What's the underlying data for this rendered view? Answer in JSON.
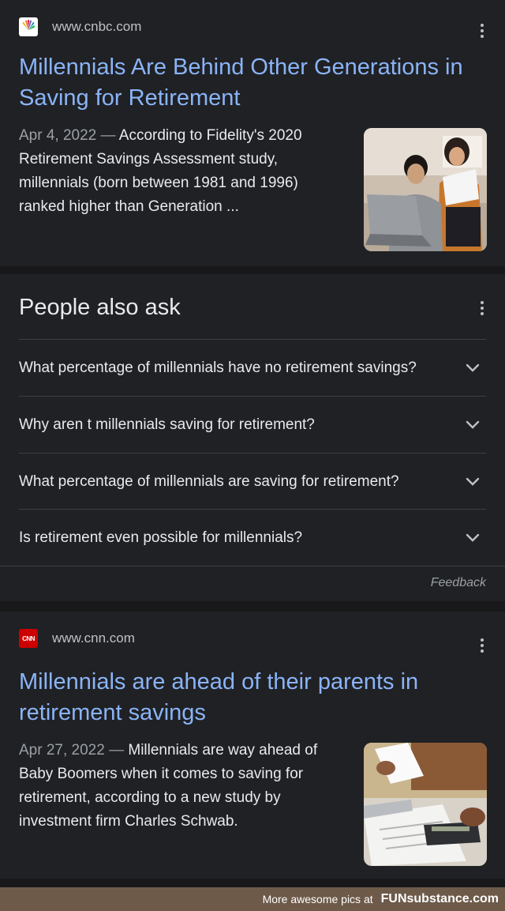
{
  "result1": {
    "site": "www.cnbc.com",
    "favicon": "cnbc-peacock-icon",
    "title": "Millennials Are Behind Other Generations in Saving for Retirement",
    "date": "Apr 4, 2022",
    "separator": " — ",
    "snippet": "According to Fidelity's 2020 Retirement Savings Assessment study, millennials (born between 1981 and 1996) ranked higher than Generation ...",
    "thumbnail": "couple-with-laptop-image"
  },
  "people_also_ask": {
    "heading": "People also ask",
    "questions": [
      "What percentage of millennials have no retirement savings?",
      "Why aren t millennials saving for retirement?",
      "What percentage of millennials are saving for retirement?",
      "Is retirement even possible for millennials?"
    ],
    "feedback": "Feedback"
  },
  "result2": {
    "site": "www.cnn.com",
    "favicon": "cnn-logo-icon",
    "favicon_text": "CNN",
    "title": "Millennials are ahead of their parents in retirement savings",
    "date": "Apr 27, 2022",
    "separator": " — ",
    "snippet": "Millennials are way ahead of Baby Boomers when it comes to saving for retirement, according to a new study by investment firm Charles Schwab.",
    "thumbnail": "person-with-calculator-image"
  },
  "footer": {
    "prefix": "More awesome pics at",
    "brand": "FUNsubstance.com"
  },
  "colors": {
    "background": "#202124",
    "link": "#8ab4f8",
    "text": "#e8eaed",
    "muted": "#9aa0a6",
    "footer": "#6d5a49"
  }
}
